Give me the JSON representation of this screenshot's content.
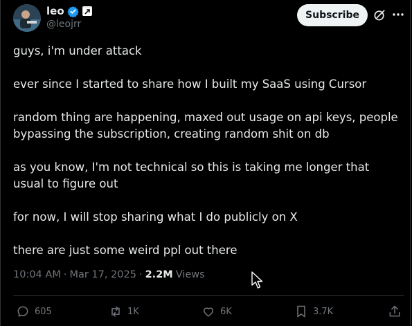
{
  "author": {
    "name": "leo",
    "handle": "@leojrr"
  },
  "header": {
    "subscribe_label": "Subscribe"
  },
  "icons": {
    "verified": "verified-badge-icon",
    "affiliate": "affiliate-badge-icon",
    "grok": "grok-icon",
    "more": "more-icon",
    "reply": "reply-icon",
    "repost": "repost-icon",
    "like": "like-icon",
    "bookmark": "bookmark-icon",
    "share": "share-icon"
  },
  "colors": {
    "background": "#000000",
    "text": "#e7e9ea",
    "muted": "#71767b",
    "verified": "#1d9bf0",
    "border": "#2f3336"
  },
  "tweet": {
    "paragraphs": [
      "guys, i'm under attack",
      "ever since I started to share how I built my SaaS using Cursor",
      "random thing are happening, maxed out usage on api keys, people bypassing the subscription, creating random shit on db",
      "as you know, I'm not technical so this is taking me longer that usual to figure out",
      "for now, I will stop sharing what I do publicly on X",
      "there are just some weird ppl out there"
    ],
    "time": "10:04 AM",
    "date": "Mar 17, 2025",
    "views_count": "2.2M",
    "views_label": "Views"
  },
  "actions": {
    "replies": "605",
    "reposts": "1K",
    "likes": "6K",
    "bookmarks": "3.7K"
  }
}
